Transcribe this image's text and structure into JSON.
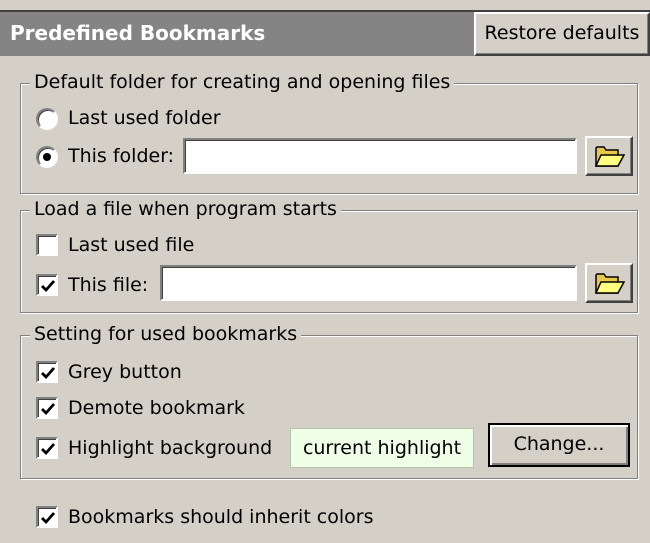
{
  "header": {
    "title": "Predefined Bookmarks",
    "restore_label": "Restore defaults"
  },
  "default_folder": {
    "legend": "Default folder for creating and opening files",
    "last_used_label": "Last used folder",
    "last_used_selected": false,
    "this_folder_label": "This folder:",
    "this_folder_selected": true,
    "folder_value": "",
    "browse_icon": "folder-open-icon"
  },
  "load_file": {
    "legend": "Load a file when program starts",
    "last_used_label": "Last used file",
    "last_used_checked": false,
    "this_file_label": "This file:",
    "this_file_checked": true,
    "file_value": "",
    "browse_icon": "folder-open-icon"
  },
  "used_bookmarks": {
    "legend": "Setting for used bookmarks",
    "grey_label": "Grey button",
    "grey_checked": true,
    "demote_label": "Demote bookmark",
    "demote_checked": true,
    "highlight_label": "Highlight background",
    "highlight_checked": true,
    "highlight_preview": "current highlight",
    "highlight_color": "#efffe7",
    "change_label": "Change..."
  },
  "inherit": {
    "label": "Bookmarks should inherit colors",
    "checked": true
  },
  "colors": {
    "window_bg": "#d4d0c8",
    "header_bg": "#848484"
  }
}
